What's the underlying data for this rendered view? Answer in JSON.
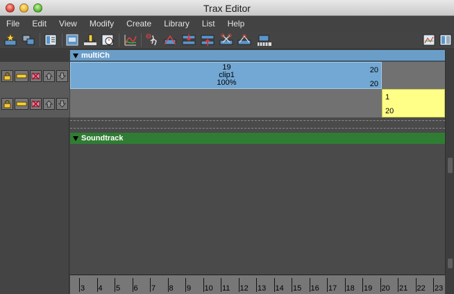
{
  "window": {
    "title": "Trax Editor"
  },
  "menu": [
    "File",
    "Edit",
    "View",
    "Modify",
    "Create",
    "Library",
    "List",
    "Help"
  ],
  "toolbar": {
    "icons": [
      "create-clip-icon",
      "merge-clips-icon",
      "graph-editor-icon",
      "frame-all-icon",
      "set-key-icon",
      "timer-icon",
      "curve-icon",
      "character-icon",
      "blend-icon",
      "track-add-icon",
      "track-remove-icon",
      "scissors-icon",
      "scissors-split-icon",
      "ruler-icon",
      "outliner-icon",
      "panel-icon"
    ]
  },
  "tracks": {
    "multich": {
      "name": "multiCh",
      "clip": {
        "start": "19",
        "name": "clip1",
        "scale": "100%",
        "end_top": "20",
        "end_bottom": "20"
      },
      "clip2": {
        "top": "1",
        "bottom": "20"
      }
    },
    "soundtrack": {
      "name": "Soundtrack"
    }
  },
  "ruler": {
    "labels": [
      "3",
      "4",
      "5",
      "6",
      "7",
      "8",
      "9",
      "10",
      "11",
      "12",
      "13",
      "14",
      "15",
      "16",
      "17",
      "18",
      "19",
      "20",
      "21",
      "22",
      "23"
    ]
  },
  "colors": {
    "multich_header": "#6a9ec9",
    "clip1": "#72a8d3",
    "clip2": "#ffff88",
    "soundtrack_header": "#2f7d33"
  }
}
